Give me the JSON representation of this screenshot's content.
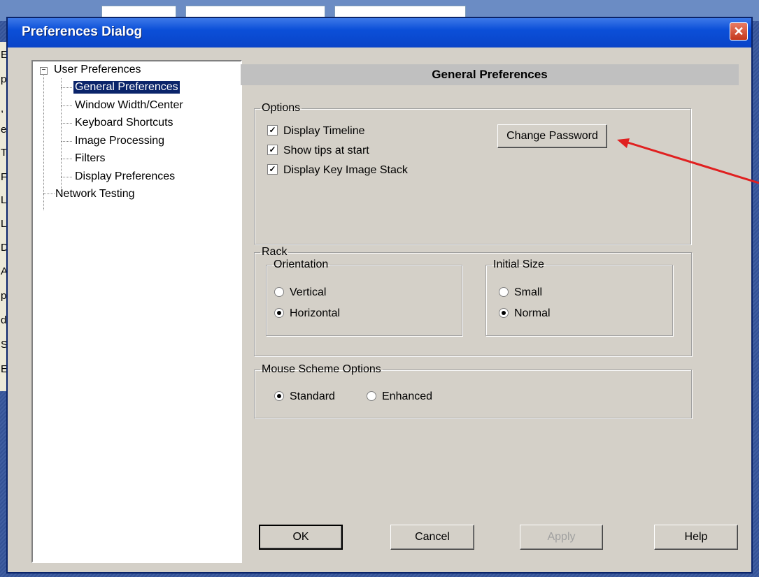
{
  "window": {
    "title": "Preferences Dialog",
    "close_glyph": "✕"
  },
  "background_app": {
    "side_letters": [
      "E",
      "ps",
      ",",
      "el",
      "TR",
      "F",
      "L",
      "L",
      "D",
      "AY",
      "ps",
      "d",
      "SS",
      "E."
    ]
  },
  "tree": {
    "items": [
      {
        "label": "User Preferences",
        "level": 0,
        "expanded": true
      },
      {
        "label": "General Preferences",
        "level": 1,
        "selected": true
      },
      {
        "label": "Window Width/Center",
        "level": 1
      },
      {
        "label": "Keyboard Shortcuts",
        "level": 1
      },
      {
        "label": "Image Processing",
        "level": 1
      },
      {
        "label": "Filters",
        "level": 1
      },
      {
        "label": "Display Preferences",
        "level": 1
      },
      {
        "label": "Network Testing",
        "level": 0
      }
    ],
    "toggle_glyph": "−"
  },
  "panel": {
    "title": "General Preferences"
  },
  "options": {
    "legend": "Options",
    "checkboxes": [
      {
        "label": "Display Timeline",
        "checked": true
      },
      {
        "label": "Show tips at start",
        "checked": true
      },
      {
        "label": "Display Key Image Stack",
        "checked": true
      }
    ],
    "check_glyph": "✓",
    "change_password_label": "Change Password"
  },
  "rack": {
    "legend": "Rack",
    "orientation": {
      "legend": "Orientation",
      "options": [
        "Vertical",
        "Horizontal"
      ],
      "selected": "Horizontal"
    },
    "initial_size": {
      "legend": "Initial Size",
      "options": [
        "Small",
        "Normal"
      ],
      "selected": "Normal"
    }
  },
  "mouse_scheme": {
    "legend": "Mouse Scheme Options",
    "options": [
      "Standard",
      "Enhanced"
    ],
    "selected": "Standard"
  },
  "buttons": {
    "ok": "OK",
    "cancel": "Cancel",
    "apply": "Apply",
    "help": "Help"
  },
  "colors": {
    "selection": "#0a246a",
    "annotation_arrow": "#e02020",
    "titlebar": "#0b4fd8"
  }
}
